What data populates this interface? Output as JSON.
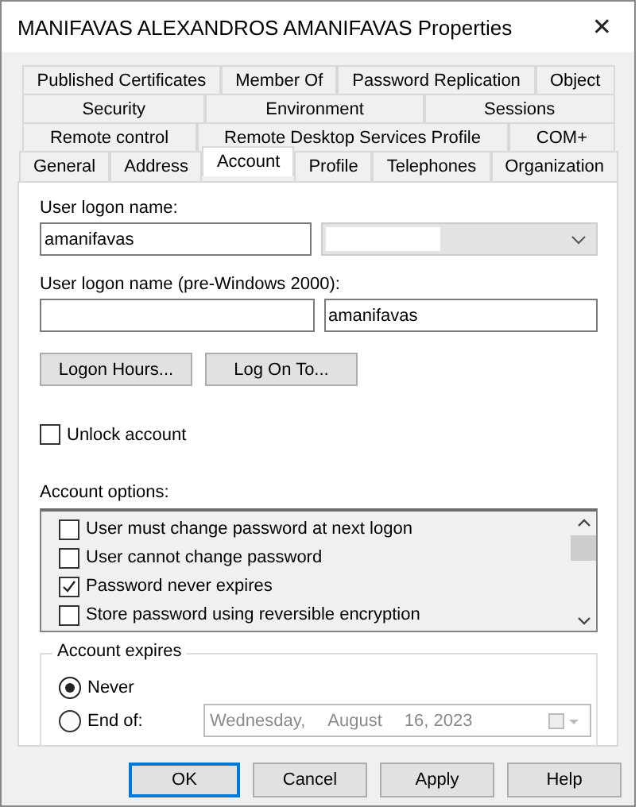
{
  "window": {
    "title": "MANIFAVAS ALEXANDROS AMANIFAVAS Properties",
    "close": "✕"
  },
  "tab_rows": [
    [
      {
        "label": "Published Certificates",
        "selected": false
      },
      {
        "label": "Member Of",
        "selected": false
      },
      {
        "label": "Password Replication",
        "selected": false
      },
      {
        "label": "Object",
        "selected": false
      }
    ],
    [
      {
        "label": "Security",
        "selected": false
      },
      {
        "label": "Environment",
        "selected": false
      },
      {
        "label": "Sessions",
        "selected": false
      }
    ],
    [
      {
        "label": "Remote control",
        "selected": false
      },
      {
        "label": "Remote Desktop Services Profile",
        "selected": false
      },
      {
        "label": "COM+",
        "selected": false
      }
    ],
    [
      {
        "label": "General",
        "selected": false
      },
      {
        "label": "Address",
        "selected": false
      },
      {
        "label": "Account",
        "selected": true
      },
      {
        "label": "Profile",
        "selected": false
      },
      {
        "label": "Telephones",
        "selected": false
      },
      {
        "label": "Organization",
        "selected": false
      }
    ]
  ],
  "logon_name": {
    "label": "User logon name:",
    "value": "amanifavas"
  },
  "pre2000": {
    "label": "User logon name (pre-Windows 2000):",
    "value": "amanifavas"
  },
  "action_buttons": [
    "Logon Hours...",
    "Log On To..."
  ],
  "unlock": {
    "label": "Unlock account",
    "checked": false
  },
  "account_options": {
    "label": "Account options:",
    "items": [
      {
        "label": "User must change password at next logon",
        "checked": false
      },
      {
        "label": "User cannot change password",
        "checked": false
      },
      {
        "label": "Password never expires",
        "checked": true
      },
      {
        "label": "Store password using reversible encryption",
        "checked": false
      }
    ]
  },
  "account_expires": {
    "label": "Account expires",
    "options": [
      {
        "label": "Never",
        "selected": true
      },
      {
        "label": "End of:",
        "selected": false
      }
    ],
    "date": {
      "weekday": "Wednesday,",
      "month": "August",
      "day_year": "16, 2023"
    }
  },
  "buttons": [
    "OK",
    "Cancel",
    "Apply",
    "Help"
  ]
}
